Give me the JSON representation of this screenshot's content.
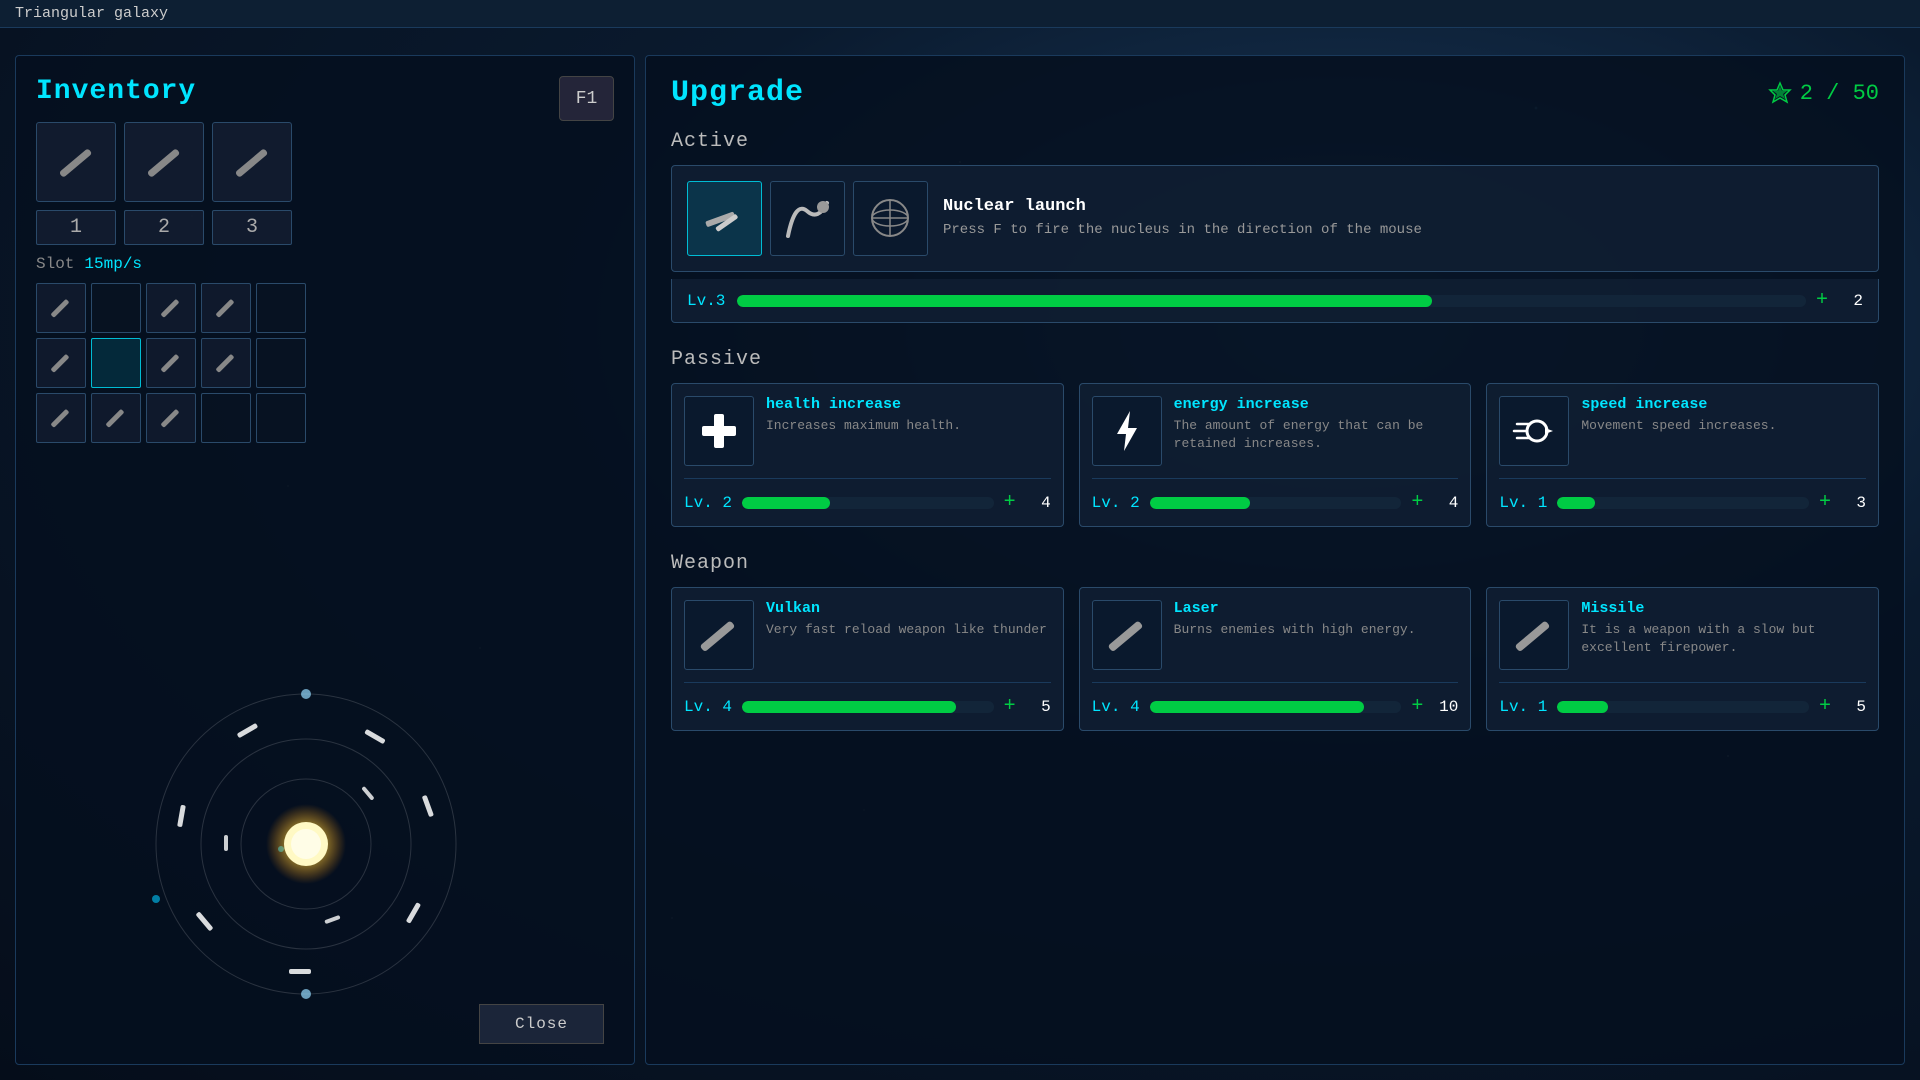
{
  "window": {
    "title": "Triangular galaxy"
  },
  "left_panel": {
    "title": "Inventory",
    "f1_key": "F1",
    "weapon_slots": [
      {
        "id": 1,
        "has_item": true
      },
      {
        "id": 2,
        "has_item": true
      },
      {
        "id": 3,
        "has_item": true
      }
    ],
    "slot_numbers": [
      "1",
      "2",
      "3"
    ],
    "slot_label": "Slot",
    "slot_mp": "15mp/s",
    "inventory_grid_rows": [
      [
        {
          "has_item": true
        },
        {
          "has_item": false,
          "active": false
        },
        {
          "has_item": true
        },
        {
          "has_item": true
        },
        {
          "has_item": false
        }
      ],
      [
        {
          "has_item": true
        },
        {
          "has_item": false,
          "active": true
        },
        {
          "has_item": true
        },
        {
          "has_item": true
        },
        {
          "has_item": false
        }
      ],
      [
        {
          "has_item": true
        },
        {
          "has_item": true
        },
        {
          "has_item": true
        },
        {
          "has_item": false
        },
        {
          "has_item": false
        }
      ]
    ],
    "close_button": "Close"
  },
  "right_panel": {
    "title": "Upgrade",
    "currency": {
      "current": 2,
      "max": 50,
      "display": "2 / 50"
    },
    "sections": {
      "active_label": "Active",
      "passive_label": "Passive",
      "weapon_label": "Weapon"
    },
    "active": {
      "name": "Nuclear launch",
      "description": "Press F to fire the nucleus in the direction of the mouse",
      "level": "Lv.3",
      "level_number": 3,
      "level_pct": 65,
      "cost": 2,
      "ability_variants": [
        "variant1",
        "variant2",
        "variant3"
      ]
    },
    "passive": [
      {
        "name": "health increase",
        "description": "Increases maximum health.",
        "level": "Lv. 2",
        "level_number": 2,
        "level_pct": 35,
        "cost": 4,
        "icon_type": "health"
      },
      {
        "name": "energy increase",
        "description": "The amount of energy that can be retained increases.",
        "level": "Lv. 2",
        "level_number": 2,
        "level_pct": 40,
        "cost": 4,
        "icon_type": "energy"
      },
      {
        "name": "speed increase",
        "description": "Movement speed increases.",
        "level": "Lv. 1",
        "level_number": 1,
        "level_pct": 15,
        "cost": 3,
        "icon_type": "speed"
      }
    ],
    "weapons": [
      {
        "name": "Vulkan",
        "description": "Very fast reload weapon like thunder",
        "level": "Lv. 4",
        "level_number": 4,
        "level_pct": 85,
        "cost": 5,
        "icon_type": "weapon"
      },
      {
        "name": "Laser",
        "description": "Burns enemies with high energy.",
        "level": "Lv. 4",
        "level_number": 4,
        "level_pct": 85,
        "cost": 10,
        "icon_type": "weapon"
      },
      {
        "name": "Missile",
        "description": "It is a weapon with a slow but excellent firepower.",
        "level": "Lv. 1",
        "level_number": 1,
        "level_pct": 20,
        "cost": 5,
        "icon_type": "weapon"
      }
    ]
  }
}
